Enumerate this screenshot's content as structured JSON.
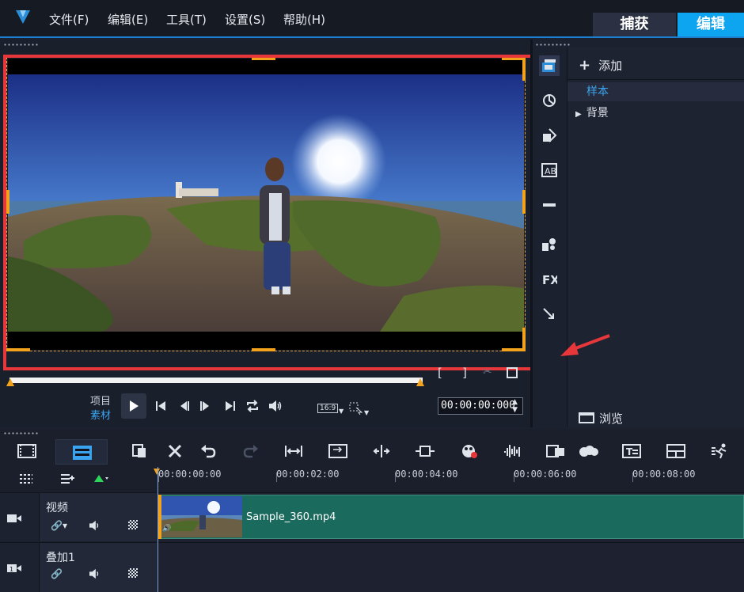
{
  "menu": {
    "file": "文件(F)",
    "edit": "编辑(E)",
    "tools": "工具(T)",
    "settings": "设置(S)",
    "help": "帮助(H)"
  },
  "workspace_tabs": {
    "capture": "捕获",
    "edit": "编辑"
  },
  "player": {
    "project_label": "项目",
    "clip_label": "素材",
    "timecode": "00:00:00:000",
    "aspect_ratio": "16:9"
  },
  "library": {
    "add_label": "添加",
    "sample_label": "样本",
    "background_label": "背景",
    "browse_label": "浏览"
  },
  "timeline": {
    "ruler_ticks": [
      "00:00:00:00",
      "00:00:02:00",
      "00:00:04:00",
      "00:00:06:00",
      "00:00:08:00"
    ],
    "tracks": [
      {
        "name": "视频"
      },
      {
        "name": "叠加1"
      }
    ],
    "clip_name": "Sample_360.mp4"
  },
  "colors": {
    "accent_blue": "#0ea5f0",
    "highlight_red": "#e8373a",
    "handle_orange": "#f2a31b",
    "clip_green": "#1a6b5e"
  }
}
